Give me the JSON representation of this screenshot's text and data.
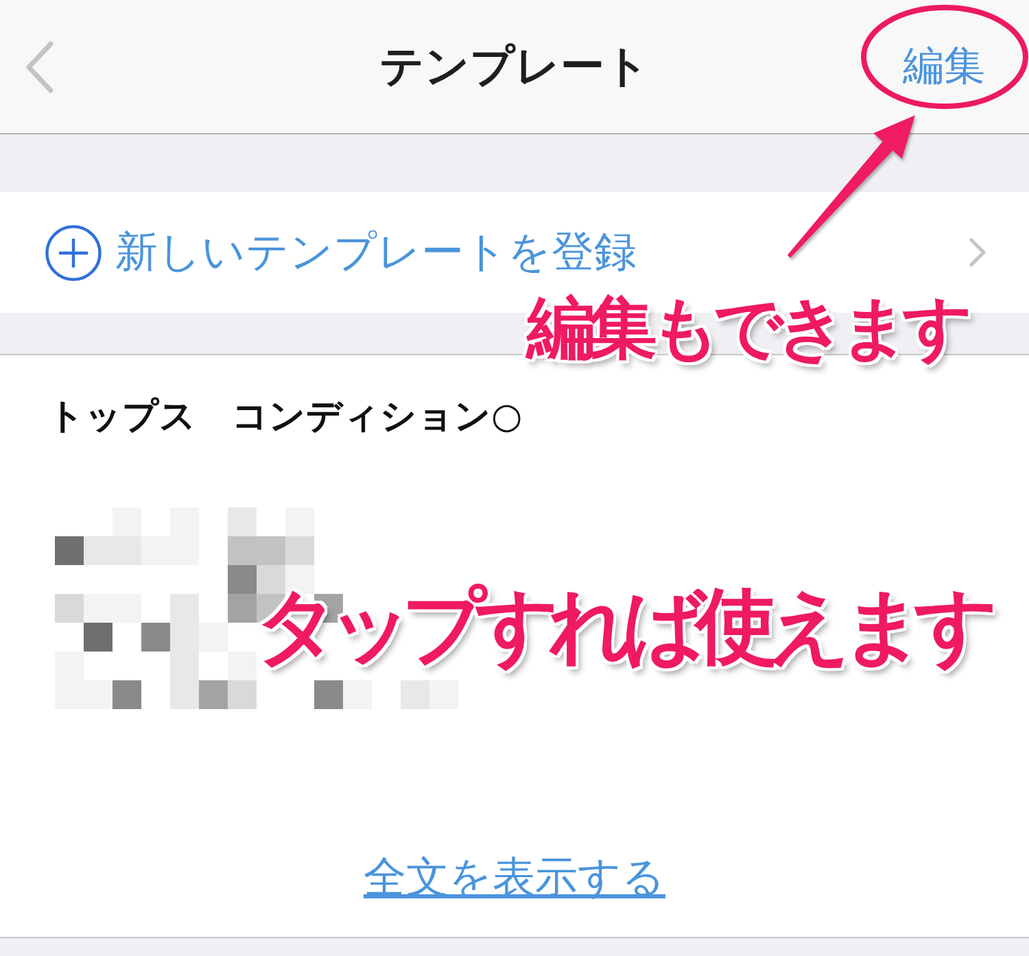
{
  "nav_bar": {
    "title": "テンプレート",
    "edit_button": "編集"
  },
  "new_template_row": {
    "label": "新しいテンプレートを登録"
  },
  "template_card": {
    "title": "トップス　コンディション○",
    "show_full_text_link": "全文を表示する"
  },
  "annotations": {
    "edit_hint": "編集もできます",
    "tap_hint": "タップすれば使えます"
  }
}
